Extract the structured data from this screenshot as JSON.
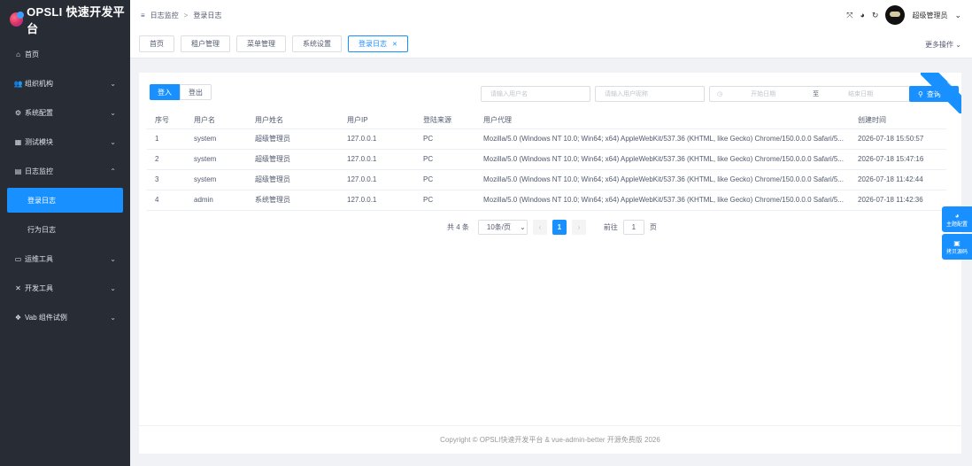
{
  "logo": {
    "text": "OPSLI 快速开发平台"
  },
  "sidebar": {
    "items": [
      {
        "icon": "home-icon",
        "glyph": "⌂",
        "label": "首页",
        "chevron": ""
      },
      {
        "icon": "users-icon",
        "glyph": "👥",
        "label": "组织机构",
        "chevron": "⌄"
      },
      {
        "icon": "gear-icon",
        "glyph": "⚙",
        "label": "系统配置",
        "chevron": "⌄"
      },
      {
        "icon": "box-icon",
        "glyph": "▦",
        "label": "测试模块",
        "chevron": "⌄"
      },
      {
        "icon": "file-icon",
        "glyph": "▤",
        "label": "日志监控",
        "chevron": "⌃"
      }
    ],
    "sub_items": [
      {
        "label": "登录日志",
        "active": true
      },
      {
        "label": "行为日志",
        "active": false
      }
    ],
    "items_after": [
      {
        "icon": "monitor-icon",
        "glyph": "▭",
        "label": "运维工具",
        "chevron": "⌄"
      },
      {
        "icon": "tools-icon",
        "glyph": "✕",
        "label": "开发工具",
        "chevron": "⌄"
      },
      {
        "icon": "puzzle-icon",
        "glyph": "❖",
        "label": "Vab 组件试例",
        "chevron": "⌄"
      }
    ]
  },
  "header": {
    "breadcrumb": [
      "日志监控",
      "登录日志"
    ],
    "breadcrumb_sep": ">",
    "user_name": "超级管理员",
    "more_label": "更多操作"
  },
  "tabs": [
    {
      "label": "首页",
      "active": false
    },
    {
      "label": "租户管理",
      "active": false
    },
    {
      "label": "菜单管理",
      "active": false
    },
    {
      "label": "系统设置",
      "active": false
    },
    {
      "label": "登录日志",
      "active": true
    }
  ],
  "toolbar": {
    "login_label": "登入",
    "logout_label": "登出"
  },
  "filters": {
    "username_placeholder": "请输入用户名",
    "realname_placeholder": "请输入用户昵称",
    "start_date_placeholder": "开始日期",
    "range_sep": "至",
    "end_date_placeholder": "结束日期",
    "search_label": "查询"
  },
  "table": {
    "headers": [
      "序号",
      "用户名",
      "用户姓名",
      "用户IP",
      "登陆来源",
      "用户代理",
      "创建时间"
    ],
    "rows": [
      [
        "1",
        "system",
        "超级管理员",
        "127.0.0.1",
        "PC",
        "Mozilla/5.0 (Windows NT 10.0; Win64; x64) AppleWebKit/537.36 (KHTML, like Gecko) Chrome/150.0.0.0 Safari/5...",
        "2026-07-18 15:50:57"
      ],
      [
        "2",
        "system",
        "超级管理员",
        "127.0.0.1",
        "PC",
        "Mozilla/5.0 (Windows NT 10.0; Win64; x64) AppleWebKit/537.36 (KHTML, like Gecko) Chrome/150.0.0.0 Safari/5...",
        "2026-07-18 15:47:16"
      ],
      [
        "3",
        "system",
        "超级管理员",
        "127.0.0.1",
        "PC",
        "Mozilla/5.0 (Windows NT 10.0; Win64; x64) AppleWebKit/537.36 (KHTML, like Gecko) Chrome/150.0.0.0 Safari/5...",
        "2026-07-18 11:42:44"
      ],
      [
        "4",
        "admin",
        "系统管理员",
        "127.0.0.1",
        "PC",
        "Mozilla/5.0 (Windows NT 10.0; Win64; x64) AppleWebKit/537.36 (KHTML, like Gecko) Chrome/150.0.0.0 Safari/5...",
        "2026-07-18 11:42:36"
      ]
    ]
  },
  "pagination": {
    "total_text": "共 4 条",
    "page_size": "10条/页",
    "current_page": "1",
    "goto_label": "前往",
    "goto_value": "1",
    "page_unit": "页"
  },
  "footer": {
    "text": "Copyright © OPSLI快速开发平台 & vue-admin-better 开源免费版 2026"
  },
  "side_tools": {
    "theme_label": "主题配置",
    "copy_label": "拷贝源码"
  },
  "colors": {
    "accent": "#1890ff",
    "sidebar_bg": "#282c34"
  }
}
